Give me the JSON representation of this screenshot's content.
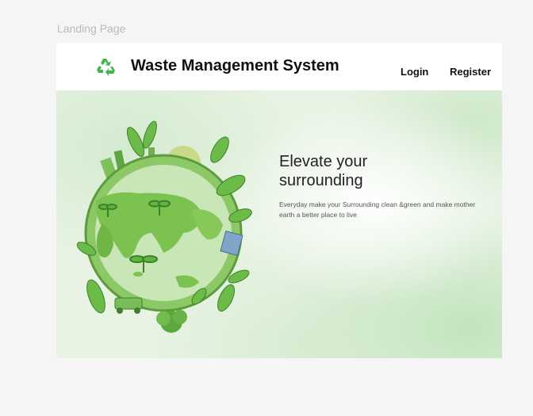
{
  "frame_label": "Landing Page",
  "navbar": {
    "brand": "Waste Management System",
    "logo_icon": "recycle-icon",
    "links": {
      "login": "Login",
      "register": "Register"
    }
  },
  "hero": {
    "title_line1": "Elevate your",
    "title_line2": "surrounding",
    "description": "Everyday make your Surrounding clean &green and make mother earth a better place to live",
    "illustration": "green-earth-illustration"
  },
  "colors": {
    "brand_green": "#3fb54a",
    "hero_bg": "#e8f3e4",
    "globe_green": "#7cc251",
    "ocean": "#c9e6b7"
  }
}
